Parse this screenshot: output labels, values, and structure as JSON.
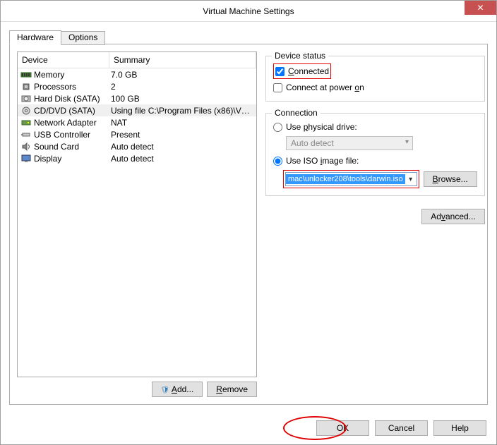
{
  "window": {
    "title": "Virtual Machine Settings"
  },
  "tabs": {
    "hardware": "Hardware",
    "options": "Options"
  },
  "list": {
    "header_device": "Device",
    "header_summary": "Summary",
    "rows": [
      {
        "name": "Memory",
        "summary": "7.0 GB",
        "icon": "memory"
      },
      {
        "name": "Processors",
        "summary": "2",
        "icon": "cpu"
      },
      {
        "name": "Hard Disk (SATA)",
        "summary": "100 GB",
        "icon": "hdd"
      },
      {
        "name": "CD/DVD (SATA)",
        "summary": "Using file C:\\Program Files (x86)\\VM...",
        "icon": "cd",
        "selected": true
      },
      {
        "name": "Network Adapter",
        "summary": "NAT",
        "icon": "net"
      },
      {
        "name": "USB Controller",
        "summary": "Present",
        "icon": "usb"
      },
      {
        "name": "Sound Card",
        "summary": "Auto detect",
        "icon": "sound"
      },
      {
        "name": "Display",
        "summary": "Auto detect",
        "icon": "display"
      }
    ]
  },
  "left_buttons": {
    "add": "Add...",
    "remove": "Remove"
  },
  "device_status": {
    "legend": "Device status",
    "connected": "Connected",
    "connect_power": "Connect at power on"
  },
  "connection": {
    "legend": "Connection",
    "use_physical": "Use physical drive:",
    "physical_dd": "Auto detect",
    "use_iso": "Use ISO image file:",
    "iso_path": "mac\\unlocker208\\tools\\darwin.iso",
    "browse": "Browse..."
  },
  "advanced": "Advanced...",
  "bottom": {
    "ok": "OK",
    "cancel": "Cancel",
    "help": "Help"
  }
}
